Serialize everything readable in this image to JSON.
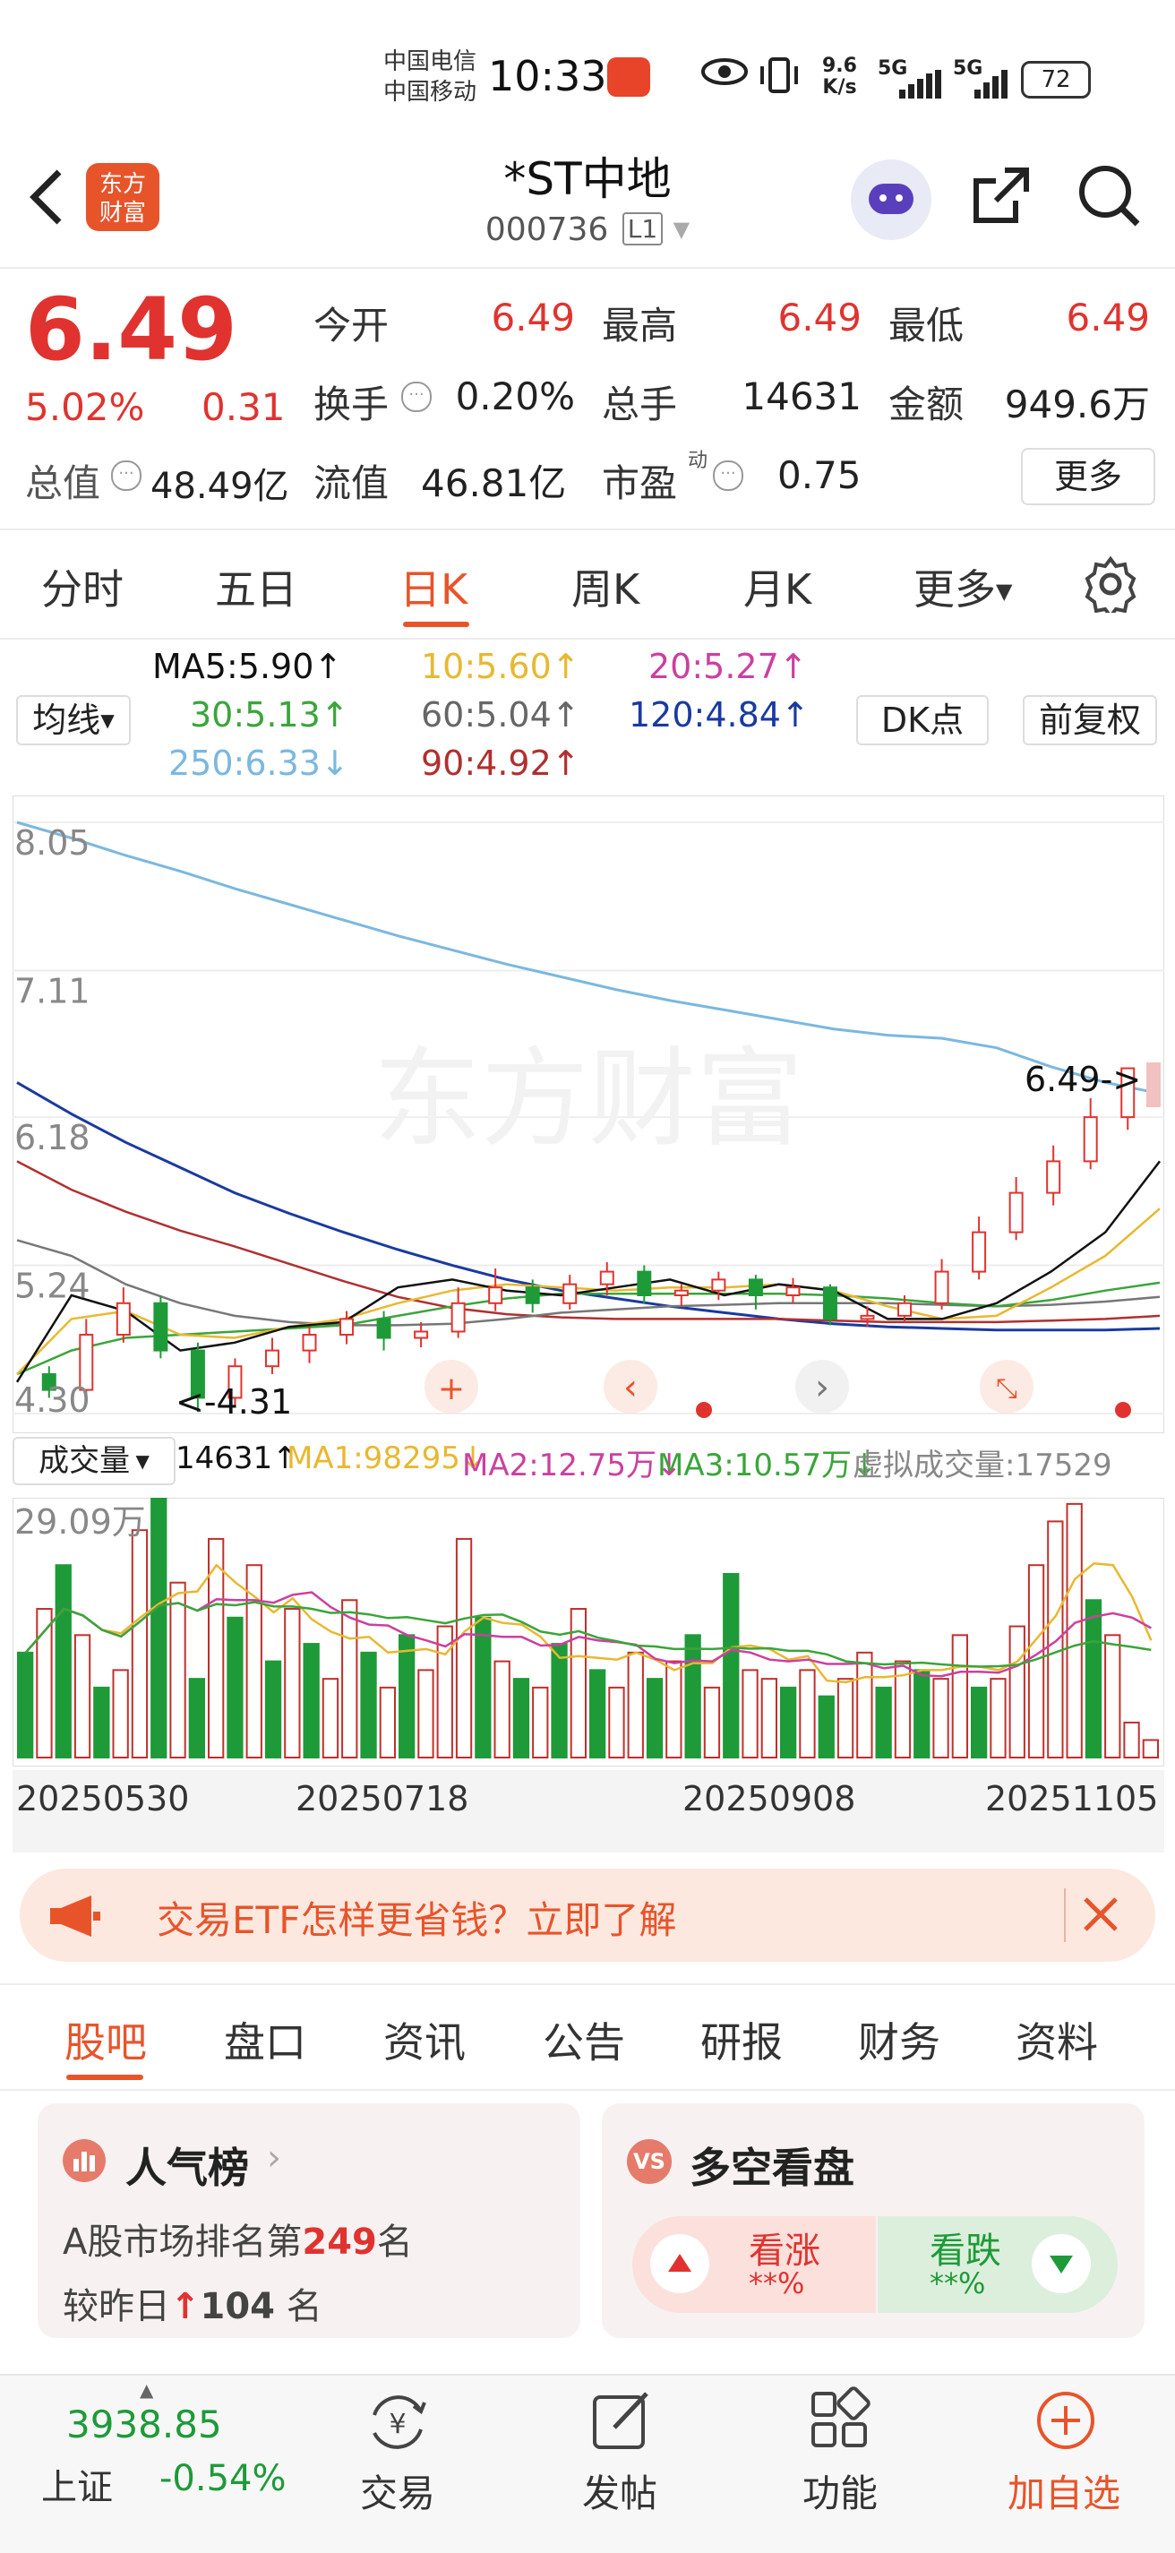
{
  "status_bar": {
    "carrier1": "中国电信",
    "carrier2": "中国移动",
    "time": "10:33",
    "net_speed_value": "9.6",
    "net_speed_unit": "K/s",
    "signal1": "5G",
    "signal2": "5G",
    "battery": "72"
  },
  "header": {
    "logo_line1": "东方",
    "logo_line2": "财富",
    "title": "*ST中地",
    "code": "000736",
    "level": "L1"
  },
  "quote": {
    "price": "6.49",
    "change_pct": "5.02%",
    "change": "0.31",
    "open_label": "今开",
    "open": "6.49",
    "high_label": "最高",
    "high": "6.49",
    "low_label": "最低",
    "low": "6.49",
    "turnover_label": "换手",
    "turnover": "0.20%",
    "volume_label": "总手",
    "volume": "14631",
    "amount_label": "金额",
    "amount": "949.6万",
    "mktcap_label": "总值",
    "mktcap": "48.49亿",
    "float_label": "流值",
    "float": "46.81亿",
    "pe_label": "市盈",
    "pe_sup": "动",
    "pe": "0.75",
    "more": "更多"
  },
  "tabs": [
    "分时",
    "五日",
    "日K",
    "周K",
    "月K",
    "更多"
  ],
  "ma_legend": {
    "selector": "均线",
    "ma5": "MA5:5.90↑",
    "ma10": "10:5.60↑",
    "ma20": "20:5.27↑",
    "ma30": "30:5.13↑",
    "ma60": "60:5.04↑",
    "ma120": "120:4.84↑",
    "ma250": "250:6.33↓",
    "ma90": "90:4.92↑",
    "dk": "DK点",
    "adjust": "前复权"
  },
  "colors": {
    "accent": "#e8542a",
    "up": "#e0332f",
    "down": "#1e9a39",
    "ma5": "#111111",
    "ma10": "#e8b830",
    "ma20": "#cc3fa0",
    "ma30": "#3aa53a",
    "ma60": "#777777",
    "ma120": "#1a3aa0",
    "ma250": "#7ab8e0",
    "ma90": "#b03030"
  },
  "chart_data": {
    "type": "candlestick",
    "y_ticks": [
      "8.05",
      "7.11",
      "6.18",
      "5.24",
      "4.30"
    ],
    "ylim": [
      4.3,
      8.05
    ],
    "price_marker": "6.49->",
    "low_marker": "<-4.31",
    "watermark": "东方财富",
    "dates": [
      "20250530",
      "20250718",
      "20250908",
      "20251105"
    ],
    "ma250": [
      8.05,
      7.95,
      7.84,
      7.74,
      7.63,
      7.53,
      7.43,
      7.33,
      7.24,
      7.15,
      7.07,
      6.99,
      6.92,
      6.86,
      6.8,
      6.74,
      6.7,
      6.68,
      6.62,
      6.5,
      6.4,
      6.33
    ],
    "ma120": [
      6.4,
      6.2,
      6.02,
      5.86,
      5.7,
      5.57,
      5.45,
      5.34,
      5.24,
      5.15,
      5.08,
      5.03,
      4.98,
      4.94,
      4.9,
      4.87,
      4.85,
      4.84,
      4.83,
      4.83,
      4.83,
      4.84
    ],
    "ma90": [
      5.9,
      5.72,
      5.58,
      5.46,
      5.36,
      5.25,
      5.14,
      5.04,
      4.97,
      4.93,
      4.91,
      4.9,
      4.9,
      4.9,
      4.9,
      4.89,
      4.88,
      4.88,
      4.88,
      4.89,
      4.9,
      4.92
    ],
    "ma60": [
      5.4,
      5.3,
      5.12,
      5.0,
      4.92,
      4.88,
      4.86,
      4.86,
      4.87,
      4.9,
      4.94,
      4.96,
      4.98,
      4.99,
      5.0,
      5.0,
      5.0,
      4.99,
      4.98,
      4.99,
      5.01,
      5.04
    ],
    "ma30": [
      4.55,
      4.7,
      4.78,
      4.8,
      4.82,
      4.84,
      4.86,
      4.92,
      4.98,
      5.03,
      5.06,
      5.06,
      5.06,
      5.06,
      5.06,
      5.05,
      5.03,
      5.0,
      4.98,
      5.02,
      5.08,
      5.13
    ],
    "ma10": [
      4.55,
      4.9,
      4.95,
      4.8,
      4.78,
      4.85,
      4.9,
      5.0,
      5.08,
      5.12,
      5.1,
      5.08,
      5.1,
      5.1,
      5.12,
      5.08,
      4.98,
      4.9,
      4.92,
      5.1,
      5.3,
      5.6
    ],
    "ma5": [
      4.5,
      5.05,
      4.95,
      4.7,
      4.75,
      4.85,
      4.88,
      5.1,
      5.15,
      5.08,
      5.05,
      5.1,
      5.15,
      5.05,
      5.12,
      5.08,
      4.9,
      4.9,
      5.0,
      5.2,
      5.45,
      5.9
    ],
    "candles": [
      {
        "o": 4.55,
        "c": 4.45,
        "h": 4.6,
        "l": 4.4
      },
      {
        "o": 4.45,
        "c": 4.8,
        "h": 4.9,
        "l": 4.42
      },
      {
        "o": 4.8,
        "c": 5.0,
        "h": 5.1,
        "l": 4.75
      },
      {
        "o": 5.0,
        "c": 4.7,
        "h": 5.05,
        "l": 4.65
      },
      {
        "o": 4.7,
        "c": 4.4,
        "h": 4.75,
        "l": 4.31
      },
      {
        "o": 4.4,
        "c": 4.6,
        "h": 4.65,
        "l": 4.35
      },
      {
        "o": 4.6,
        "c": 4.7,
        "h": 4.78,
        "l": 4.55
      },
      {
        "o": 4.7,
        "c": 4.8,
        "h": 4.85,
        "l": 4.62
      },
      {
        "o": 4.8,
        "c": 4.9,
        "h": 4.95,
        "l": 4.74
      },
      {
        "o": 4.9,
        "c": 4.78,
        "h": 4.95,
        "l": 4.7
      },
      {
        "o": 4.78,
        "c": 4.82,
        "h": 4.88,
        "l": 4.72
      },
      {
        "o": 4.82,
        "c": 5.0,
        "h": 5.1,
        "l": 4.78
      },
      {
        "o": 5.0,
        "c": 5.1,
        "h": 5.22,
        "l": 4.95
      },
      {
        "o": 5.1,
        "c": 5.0,
        "h": 5.15,
        "l": 4.94
      },
      {
        "o": 5.0,
        "c": 5.12,
        "h": 5.18,
        "l": 4.96
      },
      {
        "o": 5.12,
        "c": 5.2,
        "h": 5.26,
        "l": 5.05
      },
      {
        "o": 5.2,
        "c": 5.05,
        "h": 5.24,
        "l": 5.0
      },
      {
        "o": 5.05,
        "c": 5.08,
        "h": 5.12,
        "l": 4.98
      },
      {
        "o": 5.08,
        "c": 5.15,
        "h": 5.2,
        "l": 5.02
      },
      {
        "o": 5.15,
        "c": 5.05,
        "h": 5.18,
        "l": 4.96
      },
      {
        "o": 5.05,
        "c": 5.1,
        "h": 5.16,
        "l": 5.0
      },
      {
        "o": 5.1,
        "c": 4.9,
        "h": 5.12,
        "l": 4.86
      },
      {
        "o": 4.9,
        "c": 4.92,
        "h": 4.98,
        "l": 4.85
      },
      {
        "o": 4.92,
        "c": 5.0,
        "h": 5.05,
        "l": 4.88
      },
      {
        "o": 5.0,
        "c": 5.2,
        "h": 5.28,
        "l": 4.96
      },
      {
        "o": 5.2,
        "c": 5.45,
        "h": 5.55,
        "l": 5.15
      },
      {
        "o": 5.45,
        "c": 5.7,
        "h": 5.8,
        "l": 5.4
      },
      {
        "o": 5.7,
        "c": 5.9,
        "h": 6.0,
        "l": 5.62
      },
      {
        "o": 5.9,
        "c": 6.18,
        "h": 6.3,
        "l": 5.85
      },
      {
        "o": 6.18,
        "c": 6.49,
        "h": 6.49,
        "l": 6.1
      }
    ]
  },
  "volume": {
    "selector": "成交量",
    "vol": "14631↑",
    "ma1": "MA1:98295↓",
    "ma2": "MA2:12.75万↓",
    "ma3": "MA3:10.57万↓",
    "virtual": "虚拟成交量:17529",
    "max_label": "29.09万",
    "ymax": 29.09,
    "unit": "万",
    "bars": [
      {
        "v": 12,
        "up": false
      },
      {
        "v": 17,
        "up": true
      },
      {
        "v": 22,
        "up": false
      },
      {
        "v": 14,
        "up": true
      },
      {
        "v": 8,
        "up": false
      },
      {
        "v": 10,
        "up": true
      },
      {
        "v": 26,
        "up": true
      },
      {
        "v": 30,
        "up": false
      },
      {
        "v": 20,
        "up": true
      },
      {
        "v": 9,
        "up": false
      },
      {
        "v": 25,
        "up": true
      },
      {
        "v": 16,
        "up": false
      },
      {
        "v": 22,
        "up": true
      },
      {
        "v": 11,
        "up": false
      },
      {
        "v": 17,
        "up": true
      },
      {
        "v": 13,
        "up": false
      },
      {
        "v": 9,
        "up": true
      },
      {
        "v": 18,
        "up": true
      },
      {
        "v": 12,
        "up": false
      },
      {
        "v": 8,
        "up": true
      },
      {
        "v": 14,
        "up": false
      },
      {
        "v": 10,
        "up": true
      },
      {
        "v": 15,
        "up": true
      },
      {
        "v": 25,
        "up": true
      },
      {
        "v": 16,
        "up": false
      },
      {
        "v": 11,
        "up": true
      },
      {
        "v": 9,
        "up": false
      },
      {
        "v": 8,
        "up": true
      },
      {
        "v": 13,
        "up": false
      },
      {
        "v": 17,
        "up": true
      },
      {
        "v": 10,
        "up": false
      },
      {
        "v": 8,
        "up": true
      },
      {
        "v": 12,
        "up": true
      },
      {
        "v": 9,
        "up": false
      },
      {
        "v": 11,
        "up": true
      },
      {
        "v": 14,
        "up": false
      },
      {
        "v": 8,
        "up": true
      },
      {
        "v": 21,
        "up": false
      },
      {
        "v": 10,
        "up": true
      },
      {
        "v": 9,
        "up": true
      },
      {
        "v": 8,
        "up": false
      },
      {
        "v": 10,
        "up": true
      },
      {
        "v": 7,
        "up": false
      },
      {
        "v": 9,
        "up": true
      },
      {
        "v": 12,
        "up": true
      },
      {
        "v": 8,
        "up": false
      },
      {
        "v": 11,
        "up": true
      },
      {
        "v": 10,
        "up": false
      },
      {
        "v": 9,
        "up": true
      },
      {
        "v": 14,
        "up": true
      },
      {
        "v": 8,
        "up": false
      },
      {
        "v": 9,
        "up": true
      },
      {
        "v": 15,
        "up": true
      },
      {
        "v": 22,
        "up": true
      },
      {
        "v": 27,
        "up": true
      },
      {
        "v": 29,
        "up": true
      },
      {
        "v": 18,
        "up": false
      },
      {
        "v": 14,
        "up": true
      },
      {
        "v": 4,
        "up": true
      },
      {
        "v": 2,
        "up": true
      }
    ]
  },
  "banner": {
    "text": "交易ETF怎样更省钱？立即了解"
  },
  "bottom_tabs": [
    "股吧",
    "盘口",
    "资讯",
    "公告",
    "研报",
    "财务",
    "资料"
  ],
  "popularity": {
    "title": "人气榜",
    "rank_prefix": "A股市场排名第",
    "rank": "249",
    "rank_suffix": "名",
    "change_prefix": "较昨日",
    "change_arrow": "↑",
    "change": "104",
    "change_suffix": "名"
  },
  "bull_bear": {
    "badge": "VS",
    "title": "多空看盘",
    "up_label": "看涨",
    "up_value": "**%",
    "down_label": "看跌",
    "down_value": "**%"
  },
  "bottom_nav": {
    "index_value": "3938.85",
    "index_name": "上证",
    "index_change": "-0.54%",
    "trade": "交易",
    "post": "发帖",
    "features": "功能",
    "add_watch": "加自选"
  }
}
